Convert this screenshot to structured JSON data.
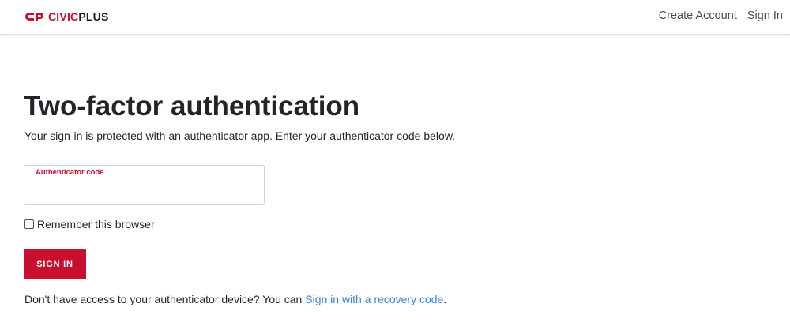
{
  "header": {
    "logo": {
      "icon": "civicplus-logo-icon",
      "text_civic": "CIVIC",
      "text_plus": "PLUS"
    },
    "nav": {
      "create_account": "Create Account",
      "sign_in": "Sign In"
    }
  },
  "main": {
    "title": "Two-factor authentication",
    "subtitle": "Your sign-in is protected with an authenticator app. Enter your authenticator code below.",
    "code_field": {
      "label": "Authenticator code",
      "value": ""
    },
    "remember": {
      "label": "Remember this browser",
      "checked": false
    },
    "submit_label": "SIGN IN",
    "footer": {
      "text_before": "Don't have access to your authenticator device? You can ",
      "link_text": "Sign in with a recovery code",
      "text_after": "."
    }
  },
  "colors": {
    "brand_red": "#c8102e",
    "link_blue": "#3b82d4",
    "text_dark": "#212529"
  }
}
